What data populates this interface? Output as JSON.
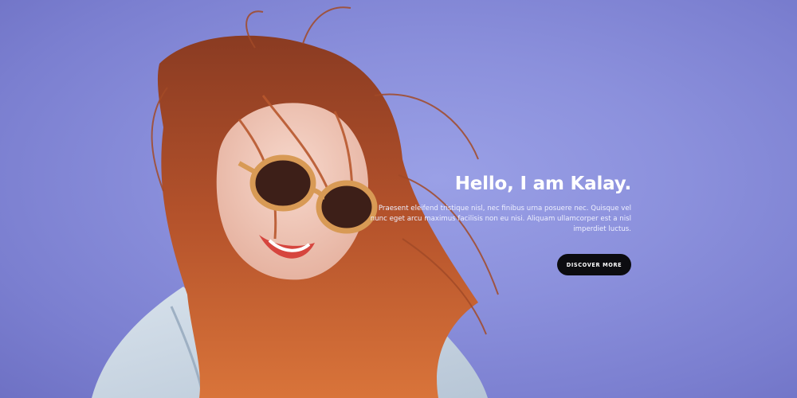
{
  "hero": {
    "title": "Hello, I am Kalay.",
    "description": "Praesent eleifend tristique nisl, nec finibus urna posuere nec. Quisque vel nunc eget arcu maximus facilisis non eu nisi. Aliquam ullamcorper est a nisl imperdiet luctus.",
    "cta_label": "DISCOVER MORE"
  },
  "colors": {
    "background": "#8b90dc",
    "button": "#0c0c10",
    "button_text": "#ffffff",
    "headline": "#ffffff"
  }
}
